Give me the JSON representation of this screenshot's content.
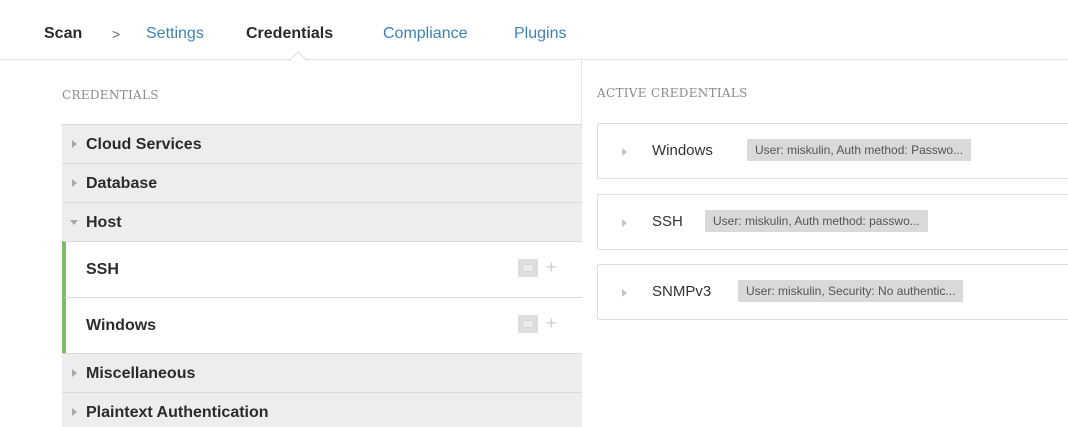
{
  "breadcrumb": {
    "root": "Scan",
    "separator": ">",
    "tabs": [
      {
        "label": "Settings",
        "active": false
      },
      {
        "label": "Credentials",
        "active": true
      },
      {
        "label": "Compliance",
        "active": false
      },
      {
        "label": "Plugins",
        "active": false
      }
    ]
  },
  "left": {
    "section_title": "CREDENTIALS",
    "categories": {
      "cloud": "Cloud Services",
      "database": "Database",
      "host": "Host",
      "misc": "Miscellaneous",
      "plaintext": "Plaintext Authentication"
    },
    "host_items": [
      {
        "label": "SSH",
        "count_icon": "∞",
        "add_icon": "+"
      },
      {
        "label": "Windows",
        "count_icon": "∞",
        "add_icon": "+"
      }
    ]
  },
  "right": {
    "section_title": "ACTIVE CREDENTIALS",
    "credentials": [
      {
        "name": "Windows",
        "summary": "User: miskulin, Auth method: Passwo..."
      },
      {
        "name": "SSH",
        "summary": "User: miskulin, Auth method: passwo..."
      },
      {
        "name": "SNMPv3",
        "summary": "User: miskulin, Security: No authentic..."
      }
    ]
  },
  "colors": {
    "accent_link": "#3e82b4",
    "selected_bar": "#7cba6d",
    "category_bg": "#ededed"
  }
}
